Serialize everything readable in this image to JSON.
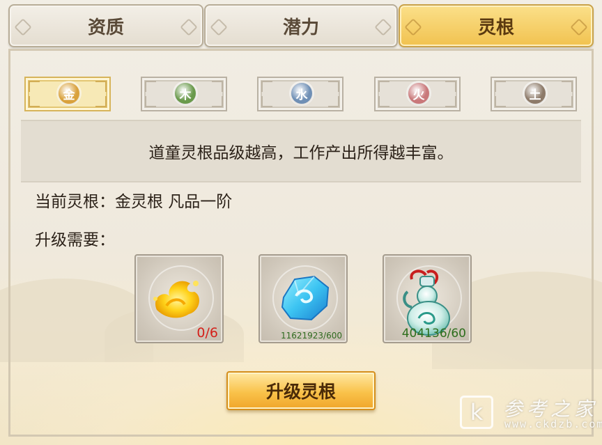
{
  "tabs": [
    {
      "label": "资质",
      "active": false
    },
    {
      "label": "潜力",
      "active": false
    },
    {
      "label": "灵根",
      "active": true
    }
  ],
  "elements": [
    {
      "label": "金",
      "color": "#d9a13c",
      "active": true
    },
    {
      "label": "木",
      "color": "#6a9a4c",
      "active": false
    },
    {
      "label": "水",
      "color": "#6f8fb5",
      "active": false
    },
    {
      "label": "火",
      "color": "#c9787a",
      "active": false
    },
    {
      "label": "土",
      "color": "#8d7a69",
      "active": false
    }
  ],
  "info": {
    "description": "道童灵根品级越高，工作产出所得越丰富。",
    "current_label": "当前灵根：",
    "current_value": "金灵根 凡品一阶",
    "requirement_label": "升级需要："
  },
  "materials": [
    {
      "icon": "gold-flame-essence-icon",
      "count": "0/6"
    },
    {
      "icon": "blue-crystal-ore-icon",
      "count": "11621923/600"
    },
    {
      "icon": "spirit-gourd-bottle-icon",
      "count": "404136/60"
    }
  ],
  "upgrade_button": "升级灵根",
  "watermark": {
    "logo": "k",
    "title": "参考之家",
    "url": "www.ckdzb.com"
  }
}
